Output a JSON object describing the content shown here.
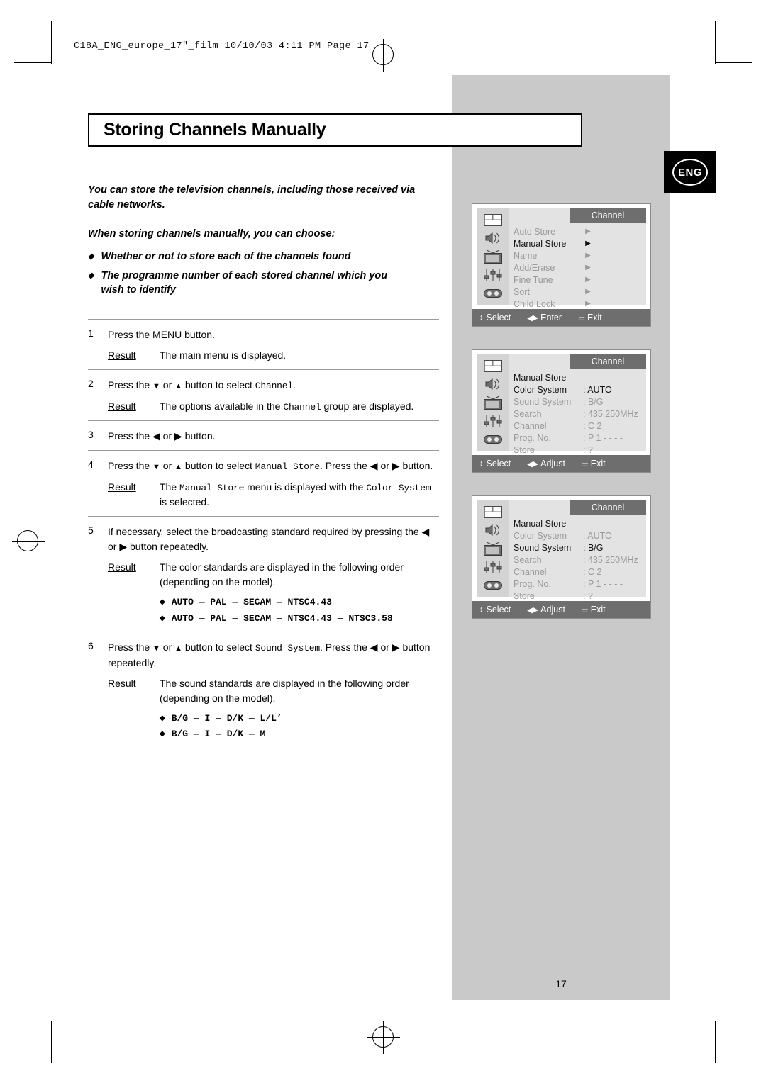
{
  "header": {
    "film_line": "C18A_ENG_europe_17\"_film  10/10/03  4:11 PM  Page 17"
  },
  "badge": {
    "label": "ENG"
  },
  "title": "Storing Channels Manually",
  "intro": {
    "line1": "You can store the television channels, including those received via",
    "line2": "cable networks.",
    "sub_head": "When storing channels manually, you can choose:",
    "bullets": [
      "Whether or not to store each of the channels found",
      "The programme number of each stored channel which you wish to identify"
    ]
  },
  "steps": [
    {
      "num": "1",
      "text": "Press the MENU button.",
      "result_label": "Result",
      "result_text": "The main menu is displayed."
    },
    {
      "num": "2",
      "text_pre": "Press the ",
      "text_mid": " or ",
      "text_post": " button to select ",
      "text_mono": "Channel",
      "text_end": ".",
      "result_label": "Result",
      "result_pre": "The options available in the ",
      "result_mono": "Channel",
      "result_post": " group are displayed."
    },
    {
      "num": "3",
      "text": "Press the ◀ or ▶ button."
    },
    {
      "num": "4",
      "text_pre": "Press the ",
      "text_mid": " or ",
      "text_post": " button to select ",
      "text_mono": "Manual Store",
      "text_end": ". Press the ◀ or ▶ button.",
      "result_label": "Result",
      "result_pre": "The ",
      "result_mono": "Manual Store",
      "result_mid": " menu is displayed with the ",
      "result_mono2": "Color System",
      "result_post": " is selected."
    },
    {
      "num": "5",
      "text": "If necessary, select the broadcasting standard required by pressing the ◀ or ▶ button repeatedly.",
      "result_label": "Result",
      "result_text": "The color standards are displayed in the following order (depending on the model).",
      "options": [
        "AUTO — PAL — SECAM — NTSC4.43",
        "AUTO — PAL — SECAM — NTSC4.43 — NTSC3.58"
      ]
    },
    {
      "num": "6",
      "text_pre": "Press the ",
      "text_mid": " or ",
      "text_post": " button to select ",
      "text_mono": "Sound System",
      "text_end": ". Press the ◀ or ▶ button repeatedly.",
      "result_label": "Result",
      "result_text": "The sound standards are displayed in the following order (depending on the model).",
      "options": [
        "B/G — I — D/K — L/L’",
        "B/G — I — D/K — M"
      ]
    }
  ],
  "osd_screens": [
    {
      "tab": "Channel",
      "rows": [
        {
          "name": "Auto Store",
          "value": "",
          "arrow": "▶",
          "state": "dim"
        },
        {
          "name": "Manual Store",
          "value": "",
          "arrow": "▶",
          "state": "on"
        },
        {
          "name": "Name",
          "value": "",
          "arrow": "▶",
          "state": "dim"
        },
        {
          "name": "Add/Erase",
          "value": "",
          "arrow": "▶",
          "state": "dim"
        },
        {
          "name": "Fine Tune",
          "value": "",
          "arrow": "▶",
          "state": "dim"
        },
        {
          "name": "Sort",
          "value": "",
          "arrow": "▶",
          "state": "dim"
        },
        {
          "name": "Child Lock",
          "value": "",
          "arrow": "▶",
          "state": "dim"
        }
      ],
      "footer": [
        {
          "icon": "↕",
          "label": "Select"
        },
        {
          "icon": "◀▶",
          "label": "Enter"
        },
        {
          "icon": "☰",
          "label": "Exit"
        }
      ]
    },
    {
      "tab": "Channel",
      "rows": [
        {
          "name": "Manual Store",
          "value": "",
          "arrow": "",
          "state": "on"
        },
        {
          "name": "Color System",
          "value": ": AUTO",
          "arrow": "",
          "state": "on"
        },
        {
          "name": "Sound System",
          "value": ": B/G",
          "arrow": "",
          "state": "dim"
        },
        {
          "name": "Search",
          "value": ": 435.250MHz",
          "arrow": "",
          "state": "dim"
        },
        {
          "name": "Channel",
          "value": ": C  2",
          "arrow": "",
          "state": "dim"
        },
        {
          "name": "Prog. No.",
          "value": ": P  1  - - - -",
          "arrow": "",
          "state": "dim"
        },
        {
          "name": "Store",
          "value": ":  ?",
          "arrow": "",
          "state": "dim"
        }
      ],
      "footer": [
        {
          "icon": "↕",
          "label": "Select"
        },
        {
          "icon": "◀▶",
          "label": "Adjust"
        },
        {
          "icon": "☰",
          "label": "Exit"
        }
      ]
    },
    {
      "tab": "Channel",
      "rows": [
        {
          "name": "Manual Store",
          "value": "",
          "arrow": "",
          "state": "on"
        },
        {
          "name": "Color System",
          "value": ": AUTO",
          "arrow": "",
          "state": "dim"
        },
        {
          "name": "Sound System",
          "value": ": B/G",
          "arrow": "",
          "state": "on"
        },
        {
          "name": "Search",
          "value": ": 435.250MHz",
          "arrow": "",
          "state": "dim"
        },
        {
          "name": "Channel",
          "value": ": C  2",
          "arrow": "",
          "state": "dim"
        },
        {
          "name": "Prog. No.",
          "value": ": P  1  - - - -",
          "arrow": "",
          "state": "dim"
        },
        {
          "name": "Store",
          "value": ":  ?",
          "arrow": "",
          "state": "dim"
        }
      ],
      "footer": [
        {
          "icon": "↕",
          "label": "Select"
        },
        {
          "icon": "◀▶",
          "label": "Adjust"
        },
        {
          "icon": "☰",
          "label": "Exit"
        }
      ]
    }
  ],
  "page_number": "17",
  "colors": {
    "panel_grey": "#c9c9c9",
    "osd_bar": "#6e6e6e",
    "osd_body": "#e3e3e3",
    "dim_text": "#9a9a9a"
  }
}
